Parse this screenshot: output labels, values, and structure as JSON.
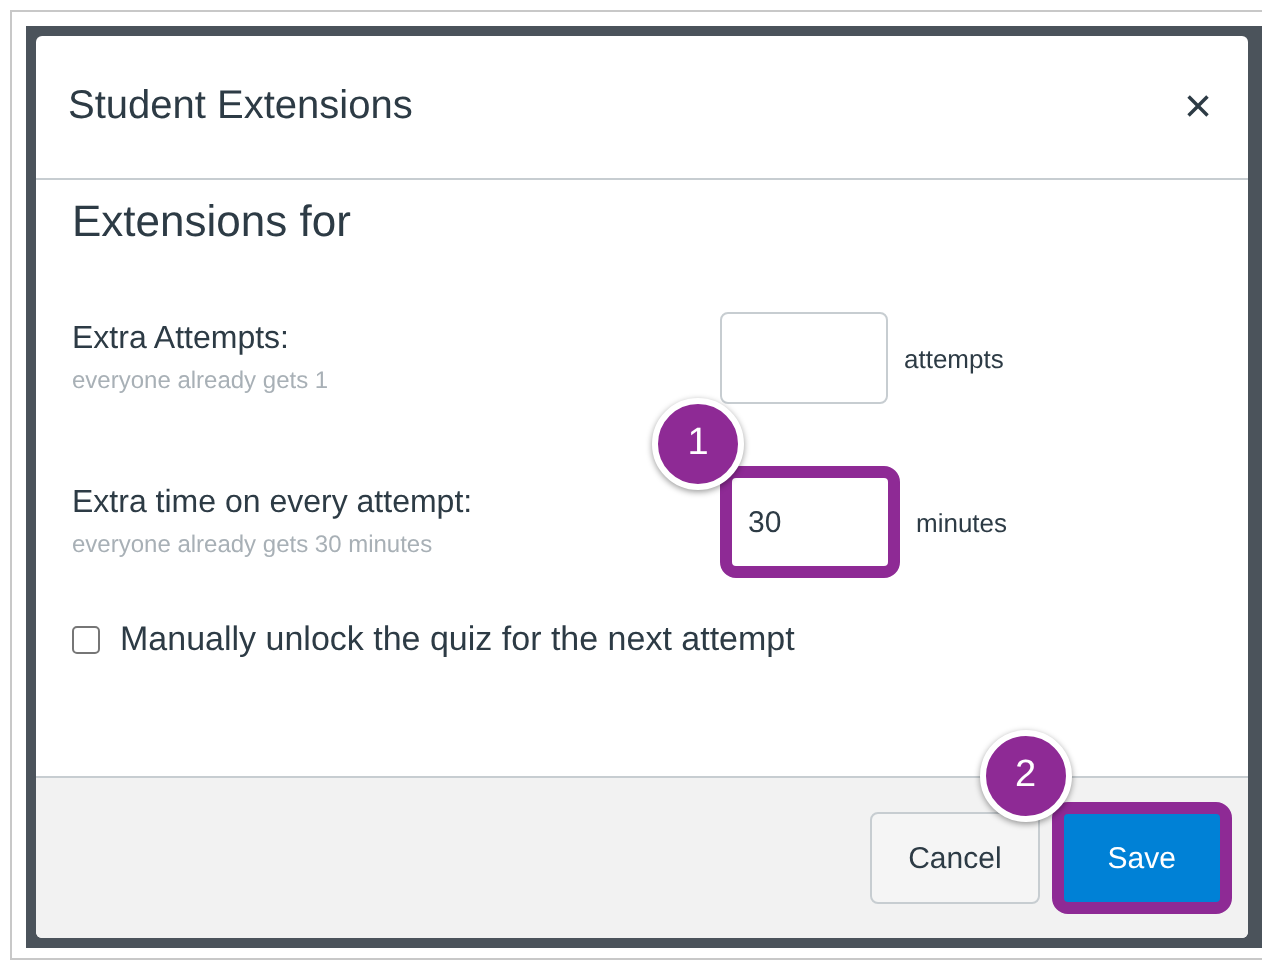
{
  "dialog": {
    "title": "Student Extensions",
    "close": "×",
    "heading": "Extensions for",
    "fields": [
      {
        "label": "Extra Attempts:",
        "hint": "everyone already gets 1",
        "unit": "attempts",
        "highlighted": false
      },
      {
        "label": "Extra time on every attempt:",
        "hint": "everyone already gets 30 minutes",
        "value": "30",
        "unit": "minutes",
        "highlighted": true,
        "callout": "1"
      }
    ],
    "checkbox": {
      "label": "Manually unlock the quiz for the next attempt",
      "checked": false
    },
    "buttons": [
      {
        "label": "Cancel",
        "kind": "secondary",
        "highlighted": false
      },
      {
        "label": "Save",
        "kind": "primary",
        "highlighted": true,
        "callout": "2"
      }
    ]
  }
}
